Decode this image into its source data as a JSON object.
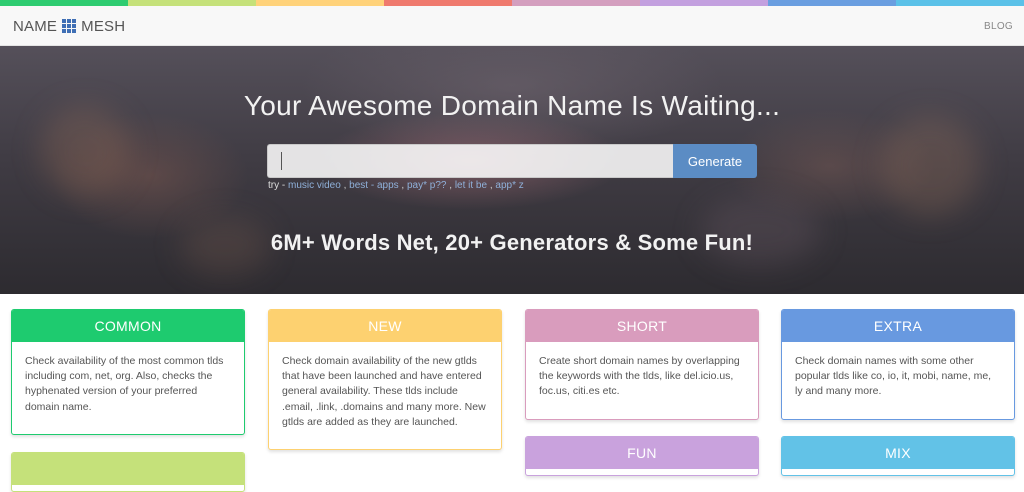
{
  "stripe_colors": [
    "#2ecc71",
    "#c5e17a",
    "#ffd27a",
    "#ef7a6e",
    "#d49fbf",
    "#c3a0df",
    "#6a9ee0",
    "#5bc1e8"
  ],
  "nav": {
    "logo_left": "NAME",
    "logo_right": "MESH",
    "blog_label": "BLOG"
  },
  "hero": {
    "title": "Your Awesome Domain Name Is Waiting...",
    "search": {
      "value": "",
      "placeholder": ""
    },
    "generate_label": "Generate",
    "try_label": "try -",
    "examples": [
      "music video",
      "best - apps",
      "pay* p??",
      "let it be",
      "app* z"
    ],
    "subtitle": "6M+ Words Net, 20+ Generators & Some Fun!"
  },
  "cards": [
    {
      "title": "COMMON",
      "color": "#1ecb6f",
      "text": "Check availability of the most common tlds including com, net, org. Also, checks the hyphenated version of your preferred domain name."
    },
    {
      "title": "NEW",
      "color": "#fdd170",
      "text": "Check domain availability of the new gtlds that have been launched and have entered general availability. These tlds include .email, .link, .domains and many more. New gtlds are added as they are launched."
    },
    {
      "title": "SHORT",
      "color": "#d99cbd",
      "text": "Create short domain names by overlapping the keywords with the tlds, like del.icio.us, foc.us, citi.es etc."
    },
    {
      "title": "EXTRA",
      "color": "#6899e0",
      "text": "Check domain names with some other popular tlds like co, io, it, mobi, name, me, ly and many more."
    },
    {
      "title": "FUN",
      "color": "#c9a2dd"
    },
    {
      "title": "MIX",
      "color": "#62c2e7"
    },
    {
      "title": "",
      "color": "#c5e17a"
    }
  ]
}
